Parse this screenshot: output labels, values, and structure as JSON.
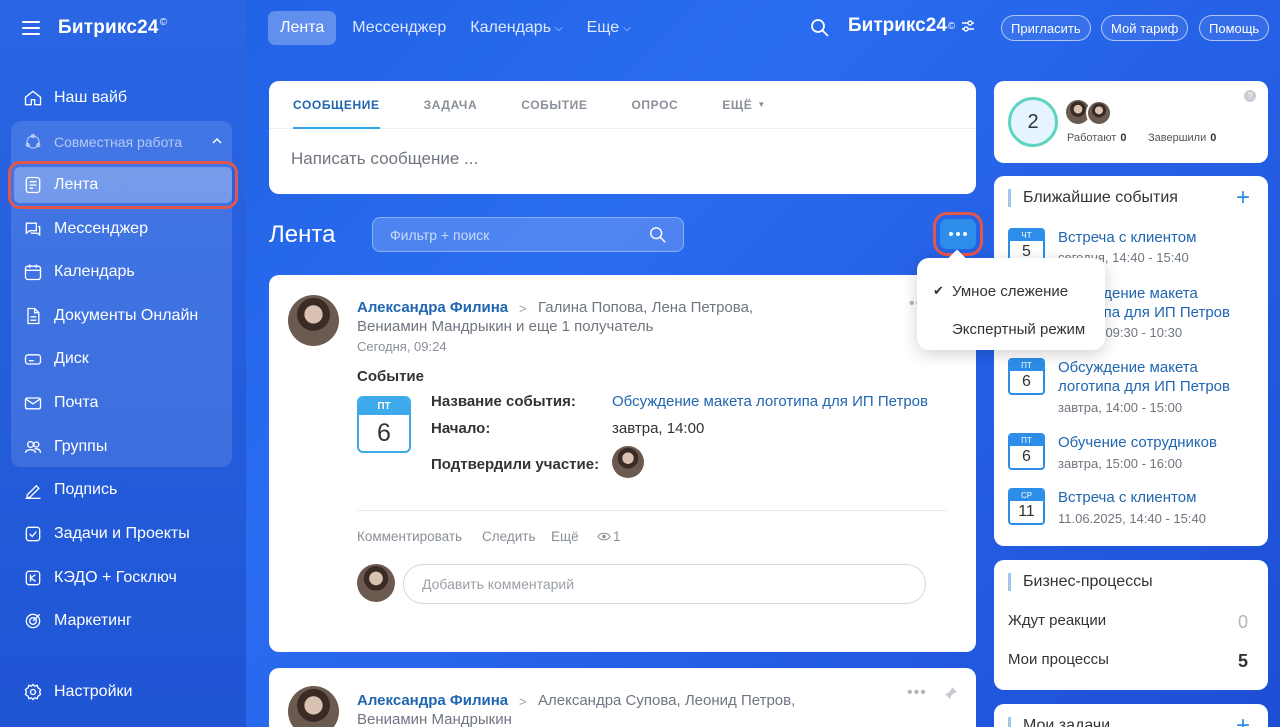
{
  "sidebar": {
    "logo": "Битрикс24",
    "logo_mark": "©",
    "items": [
      {
        "label": "Наш вайб"
      },
      {
        "label": "Совместная работа"
      },
      {
        "label": "Лента"
      },
      {
        "label": "Мессенджер"
      },
      {
        "label": "Календарь"
      },
      {
        "label": "Документы Онлайн"
      },
      {
        "label": "Диск"
      },
      {
        "label": "Почта"
      },
      {
        "label": "Группы"
      },
      {
        "label": "Подпись"
      },
      {
        "label": "Задачи и Проекты"
      },
      {
        "label": "КЭДО + Госключ"
      },
      {
        "label": "Маркетинг"
      },
      {
        "label": "Настройки"
      }
    ]
  },
  "topbar": {
    "tabs": [
      "Лента",
      "Мессенджер",
      "Календарь",
      "Еще"
    ],
    "logo": "Битрикс24",
    "logo_mark": "©",
    "buttons": [
      "Пригласить",
      "Мой тариф",
      "Помощь"
    ]
  },
  "composer": {
    "tabs": [
      "СООБЩЕНИЕ",
      "ЗАДАЧА",
      "СОБЫТИЕ",
      "ОПРОС",
      "ЕЩЁ"
    ],
    "placeholder": "Написать сообщение ..."
  },
  "feed": {
    "title": "Лента",
    "filter_placeholder": "Фильтр + поиск"
  },
  "popup": {
    "items": [
      "Умное слежение",
      "Экспертный режим"
    ],
    "check": "✔"
  },
  "post": {
    "author": "Александра Филина",
    "recipients_line1": "Галина Попова, Лена Петрова,",
    "recipients_line2": "Вениамин Мандрыкин  и еще 1 получатель",
    "time": "Сегодня, 09:24",
    "type": "Событие",
    "cal_month": "ПТ",
    "cal_day": "6",
    "fields": [
      {
        "label": "Название события:",
        "value": "Обсуждение макета логотипа для ИП Петров"
      },
      {
        "label": "Начало:",
        "value": "завтра, 14:00"
      },
      {
        "label": "Подтвердили участие:",
        "value": ""
      }
    ],
    "actions": [
      "Комментировать",
      "Следить",
      "Ещё"
    ],
    "views": "1",
    "comment_placeholder": "Добавить комментарий",
    "menu": "•••"
  },
  "post2": {
    "author": "Александра Филина",
    "recipients_line1": "Александра Супова, Леонид Петров,",
    "recipients_line2": "Вениамин Мандрыкин",
    "menu": "•••"
  },
  "stats": {
    "count": "2",
    "working_label": "Работают",
    "working_value": "0",
    "done_label": "Завершили",
    "done_value": "0",
    "help": "?"
  },
  "events": {
    "title": "Ближайшие события",
    "plus": "+",
    "items": [
      {
        "month": "ЧТ",
        "day": "5",
        "title": "Встреча с клиентом",
        "time": "сегодня, 14:40 - 15:40"
      },
      {
        "month": "ПТ",
        "day": "6",
        "title": "Обсуждение макета логотипа для ИП Петров",
        "time": "завтра, 09:30 - 10:30"
      },
      {
        "month": "ПТ",
        "day": "6",
        "title": "Обсуждение макета логотипа для ИП Петров",
        "time": "завтра, 14:00 - 15:00"
      },
      {
        "month": "ПТ",
        "day": "6",
        "title": "Обучение сотрудников",
        "time": "завтра, 15:00 - 16:00"
      },
      {
        "month": "СР",
        "day": "11",
        "title": "Встреча с клиентом",
        "time": "11.06.2025, 14:40 - 15:40"
      }
    ]
  },
  "bp": {
    "title": "Бизнес-процессы",
    "rows": [
      {
        "label": "Ждут реакции",
        "value": "0"
      },
      {
        "label": "Мои процессы",
        "value": "5"
      }
    ]
  },
  "tasks": {
    "title": "Мои задачи",
    "plus": "+"
  },
  "colors": {
    "accent": "#2c8ee8",
    "link": "#2066b0",
    "highlight": "#e2574b"
  }
}
